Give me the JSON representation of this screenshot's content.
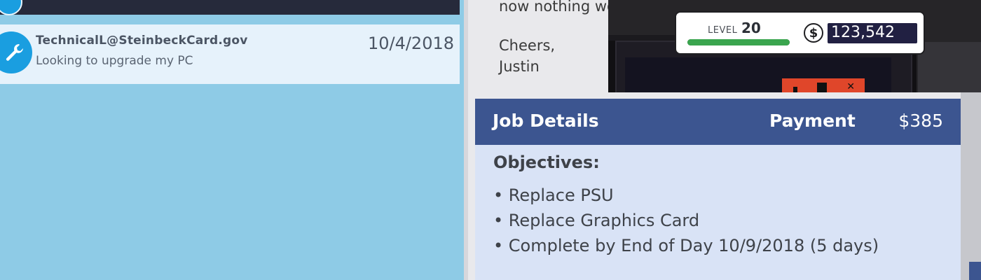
{
  "inbox": {
    "email": {
      "sender": "TechnicalL@SteinbeckCard.gov",
      "subject": "Looking to upgrade my PC",
      "date": "10/4/2018",
      "icon": "wrench-icon"
    }
  },
  "message": {
    "fragment": "now nothing wo",
    "signoff": "Cheers,",
    "name": "Justin"
  },
  "hud": {
    "level_label": "LEVEL",
    "level": "20",
    "xp_progress": 1.0,
    "currency_symbol": "$",
    "money": "123,542"
  },
  "job": {
    "title": "Job Details",
    "payment_label": "Payment",
    "payment_value": "$385",
    "objectives_heading": "Objectives:",
    "objectives": [
      "• Replace PSU",
      "• Replace Graphics Card",
      "• Complete by End of Day 10/9/2018 (5 days)"
    ]
  },
  "colors": {
    "inbox_bg": "#8ecbe6",
    "email_row_bg": "#e6f2fb",
    "job_header": "#3c5590",
    "job_body": "#d9e3f6",
    "xp_bar": "#3aa54e",
    "money_box": "#212042"
  }
}
